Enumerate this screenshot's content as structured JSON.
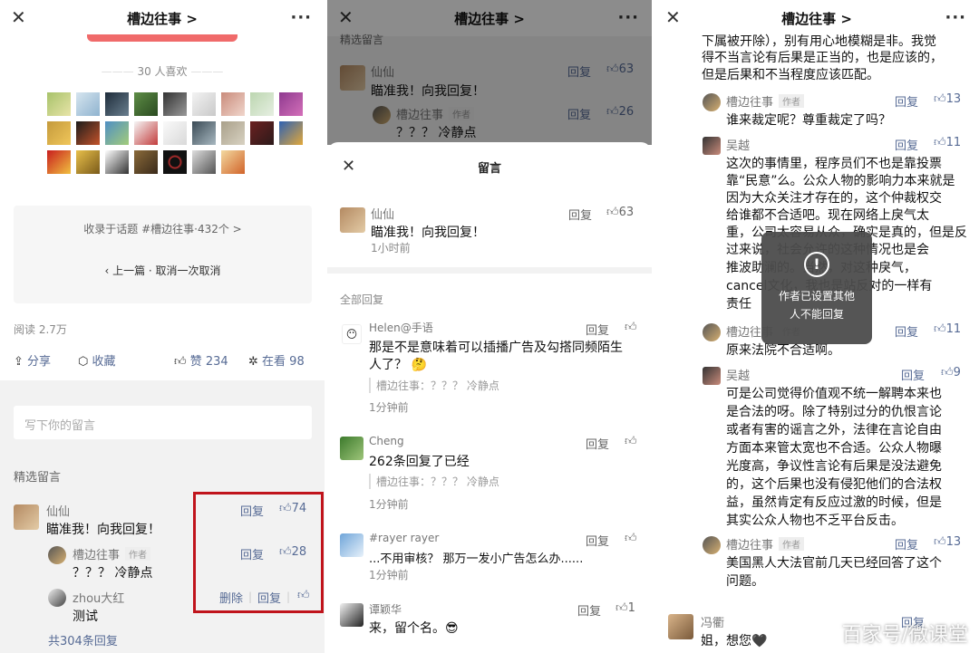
{
  "panel1": {
    "nav": {
      "title": "槽边往事 >"
    },
    "likes_count": "30 人喜欢",
    "topic": "收录于话题 #槽边往事·432个 >",
    "prev": "上一篇 · 取消一次取消",
    "read": "阅读 2.7万",
    "actions": {
      "share": "分享",
      "collect": "收藏",
      "like": "赞 234",
      "watching": "在看 98"
    },
    "comment_placeholder": "写下你的留言",
    "section": "精选留言",
    "comments": [
      {
        "name": "仙仙",
        "text": "瞄准我！向我回复！",
        "reply": "回复",
        "likes": "74"
      },
      {
        "name": "槽边往事",
        "tag": "作者",
        "text": "？？？ 冷静点",
        "reply": "回复",
        "likes": "28"
      },
      {
        "name": "zhou大红",
        "text": "测试",
        "delete": "删除",
        "reply": "回复"
      }
    ],
    "total_replies": "共304条回复"
  },
  "panel2": {
    "nav": {
      "title": "槽边往事 >"
    },
    "bg_section": "精选留言",
    "bg_comments": [
      {
        "name": "仙仙",
        "text": "瞄准我！向我回复！",
        "reply": "回复",
        "likes": "63"
      },
      {
        "name": "槽边往事",
        "tag": "作者",
        "text": "？？？ 冷静点",
        "reply": "回复",
        "likes": "26"
      }
    ],
    "sheet_title": "留言",
    "main": {
      "name": "仙仙",
      "text": "瞄准我！向我回复！",
      "time": "1小时前",
      "reply": "回复",
      "likes": "63"
    },
    "all_replies": "全部回复",
    "replies": [
      {
        "name": "Helen@手语",
        "text1": "那是不是意味着可以插播广告及勾搭同频陌生",
        "text2": "人了？ 🤔",
        "quote": "槽边往事：？？？ 冷静点",
        "time": "1分钟前",
        "reply": "回复"
      },
      {
        "name": "Cheng",
        "text1": "262条回复了已经",
        "quote": "槽边往事：？？？ 冷静点",
        "time": "1分钟前",
        "reply": "回复"
      },
      {
        "name": "#rayer rayer",
        "text1": "...不用审核？ 那万一发小广告怎么办......",
        "time": "1分钟前",
        "reply": "回复"
      },
      {
        "name": "谭颖华",
        "text1": "来，留个名。😎",
        "reply": "回复",
        "likes": "1"
      }
    ]
  },
  "panel3": {
    "nav": {
      "title": "槽边往事 >"
    },
    "top_text": [
      "下属被开除），别有用心地模糊是非。我觉",
      "得不当言论有后果是正当的，也是应该的，",
      "但是后果和不当程度应该匹配。"
    ],
    "comments": [
      {
        "name": "槽边往事",
        "tag": "作者",
        "lines": [
          "谁来裁定呢？尊重裁定了吗？"
        ],
        "reply": "回复",
        "likes": "13"
      },
      {
        "name": "吴越",
        "lines": [
          "这次的事情里，程序员们不也是靠投票",
          "靠“民意”么。公众人物的影响力本来就是",
          "因为大众关注才存在的，这个仲裁权交",
          "给谁都不合适吧。现在网络上戾气太",
          "重，公司太容易从众，确实是真的，但是反",
          "过来说，社会允许的这种情况也是会",
          "推波助澜的。当然，对这种戾气，",
          "cancel文化，我也是站反对的一样有",
          "责任"
        ],
        "reply": "回复",
        "likes": "11"
      },
      {
        "name": "槽边往事",
        "tag": "作者",
        "lines": [
          "原来法院不合适啊。"
        ],
        "reply": "回复",
        "likes": "11"
      },
      {
        "name": "吴越",
        "lines": [
          "可是公司觉得价值观不统一解聘本来也",
          "是合法的呀。除了特别过分的仇恨言论",
          "或者有害的谣言之外，法律在言论自由",
          "方面本来管太宽也不合适。公众人物曝",
          "光度高，争议性言论有后果是没法避免",
          "的，这个后果也没有侵犯他们的合法权",
          "益，虽然肯定有反应过激的时候，但是",
          "其实公众人物也不乏平台反击。"
        ],
        "reply": "回复",
        "likes": "9"
      },
      {
        "name": "槽边往事",
        "tag": "作者",
        "lines": [
          "美国黑人大法官前几天已经回答了这个",
          "问题。"
        ],
        "reply": "回复",
        "likes": "13"
      },
      {
        "name": "冯衢",
        "lines": [
          "姐，想您🖤"
        ],
        "reply": "回复"
      }
    ],
    "toast": [
      "作者已设置其他",
      "人不能回复"
    ],
    "watermark": "百家号/微课堂"
  }
}
